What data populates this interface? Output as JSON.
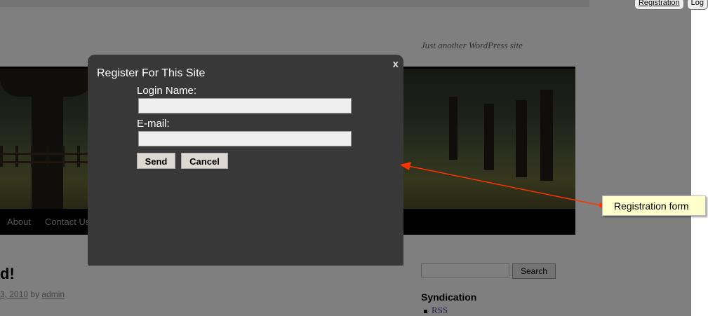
{
  "top_bar": {
    "registration_label": "Registration",
    "login_label": "Log"
  },
  "site": {
    "tagline": "Just another WordPress site"
  },
  "nav": {
    "items": [
      {
        "label": "About"
      },
      {
        "label": "Contact Us"
      }
    ]
  },
  "post": {
    "title_fragment": "d!",
    "date_fragment": "3, 2010",
    "by_label": "by",
    "author": "admin"
  },
  "sidebar": {
    "search_button": "Search",
    "syndication_heading": "Syndication",
    "rss_link": "RSS"
  },
  "modal": {
    "title": "Register For This Site",
    "close_label": "x",
    "login_label": "Login Name:",
    "login_value": "",
    "email_label": "E-mail:",
    "email_value": "",
    "send_label": "Send",
    "cancel_label": "Cancel"
  },
  "annotation": {
    "label": "Registration form",
    "arrow_color": "#ff3300"
  },
  "colors": {
    "modal_bg": "#383838",
    "nav_bg": "#000000",
    "callout_bg": "#ffffcc"
  }
}
